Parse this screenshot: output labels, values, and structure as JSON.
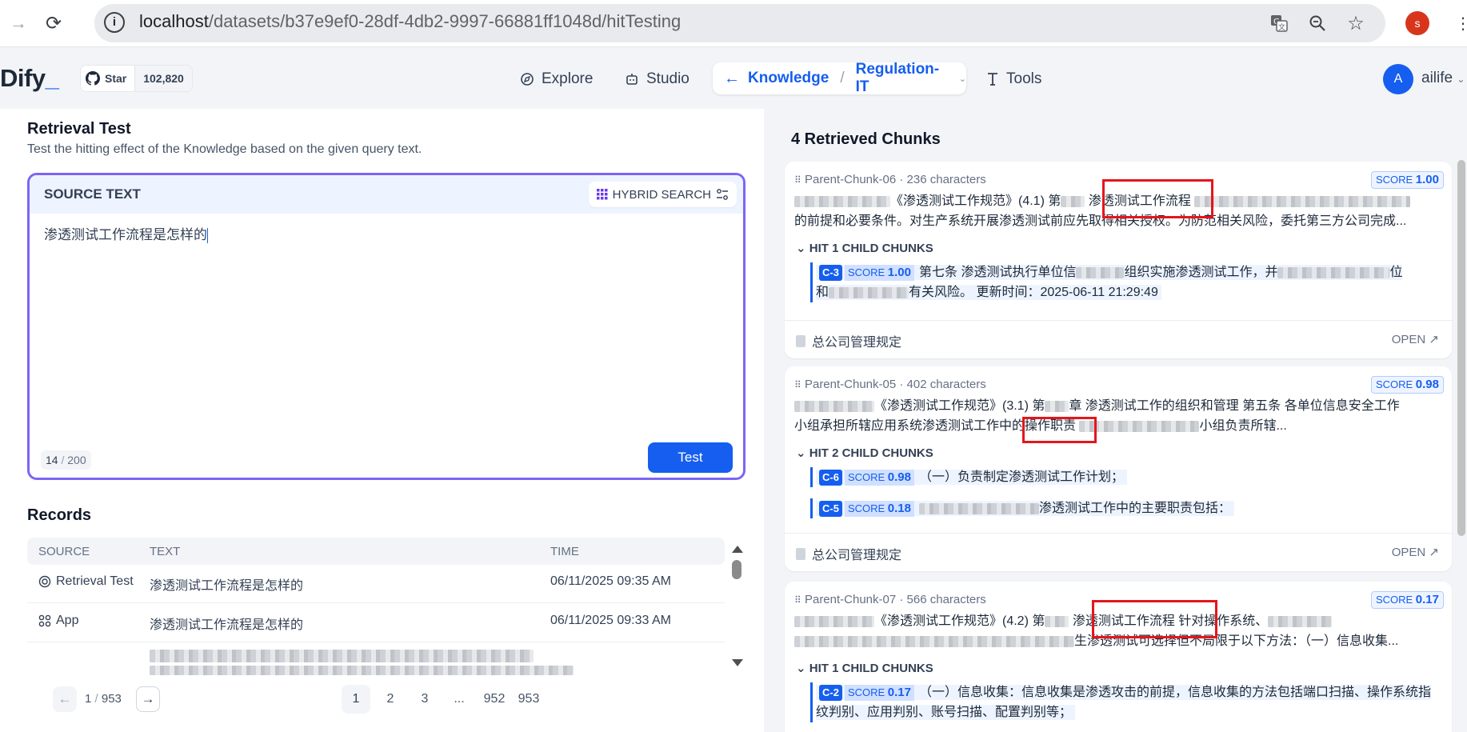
{
  "browser": {
    "url_host": "localhost",
    "url_path": "/datasets/b37e9ef0-28df-4db2-9997-66881ff1048d/hitTesting",
    "profile_initial": "s"
  },
  "header": {
    "logo": "Dify",
    "github_star_label": "Star",
    "github_star_count": "102,820",
    "nav": {
      "explore": "Explore",
      "studio": "Studio",
      "knowledge": "Knowledge",
      "dataset": "Regulation-IT",
      "tools": "Tools"
    },
    "user_initial": "A",
    "user_name": "ailife"
  },
  "retrieval_test": {
    "title": "Retrieval Test",
    "description": "Test the hitting effect of the Knowledge based on the given query text.",
    "source_label": "SOURCE TEXT",
    "search_mode": "HYBRID SEARCH",
    "query": "渗透测试工作流程是怎样的",
    "char_count": "14",
    "char_max": "200",
    "test_button": "Test"
  },
  "records": {
    "title": "Records",
    "columns": [
      "SOURCE",
      "TEXT",
      "TIME"
    ],
    "rows": [
      {
        "source": "Retrieval Test",
        "text": "渗透测试工作流程是怎样的",
        "time": "06/11/2025 09:35 AM"
      },
      {
        "source": "App",
        "text": "渗透测试工作流程是怎样的",
        "time": "06/11/2025 09:33 AM"
      }
    ],
    "pagination": {
      "current": "1",
      "total": "953",
      "pages": [
        "1",
        "2",
        "3",
        "...",
        "952",
        "953"
      ]
    }
  },
  "results": {
    "title": "4 Retrieved Chunks",
    "chunks": [
      {
        "name": "Parent-Chunk-06",
        "chars": "236 characters",
        "score_label": "SCORE",
        "score": "1.00",
        "text_line1_head": "《渗透测试工作规范》(4.1) 第",
        "text_line1_hl": "渗透测试工作流程",
        "text_line2": "的前提和必要条件。对生产系统开展渗透测试前应先取得相关授权。为防范相关风险，委托第三方公司完成...",
        "hit_label": "HIT 1 CHILD CHUNKS",
        "children": [
          {
            "tag": "C-3",
            "score": "1.00",
            "text_a": "第七条 渗透测试执行单位信",
            "text_b": "组织实施渗透测试工作，并",
            "text_c": "位",
            "text_d": "和",
            "text_e": "有关风险。 更新时间：2025-06-11 21:29:49"
          }
        ],
        "doc": "总公司管理规定",
        "open": "OPEN"
      },
      {
        "name": "Parent-Chunk-05",
        "chars": "402 characters",
        "score_label": "SCORE",
        "score": "0.98",
        "text_line1_head": "《渗透测试工作规范》(3.1) 第",
        "text_line1_tail": "章 渗透测试工作的组织和管理 第五条 各单位信息安全工作",
        "text_line2_head": "小组承担所辖应用系统渗透测试工作中",
        "text_line2_hl": "的操作职责",
        "text_line2_tail": "小组负责所辖...",
        "hit_label": "HIT 2 CHILD CHUNKS",
        "children": [
          {
            "tag": "C-6",
            "score": "0.98",
            "text": "（一）负责制定渗透测试工作计划；"
          },
          {
            "tag": "C-5",
            "score": "0.18",
            "text": "渗透测试工作中的主要职责包括："
          }
        ],
        "doc": "总公司管理规定",
        "open": "OPEN"
      },
      {
        "name": "Parent-Chunk-07",
        "chars": "566 characters",
        "score_label": "SCORE",
        "score": "0.17",
        "text_line1_head": "《渗透测试工作规范》(4.2) 第",
        "text_line1_hl": "渗透测试工作流程",
        "text_line1_tail": "针对操作系统、",
        "text_line2": "生渗透测试可选择但不局限于以下方法：（一）信息收集...",
        "hit_label": "HIT 1 CHILD CHUNKS",
        "children": [
          {
            "tag": "C-2",
            "score": "0.17",
            "text": "（一）信息收集：信息收集是渗透攻击的前提，信息收集的方法包括端口扫描、操作系统指纹判别、应用判别、账号扫描、配置判别等；"
          }
        ]
      }
    ]
  }
}
